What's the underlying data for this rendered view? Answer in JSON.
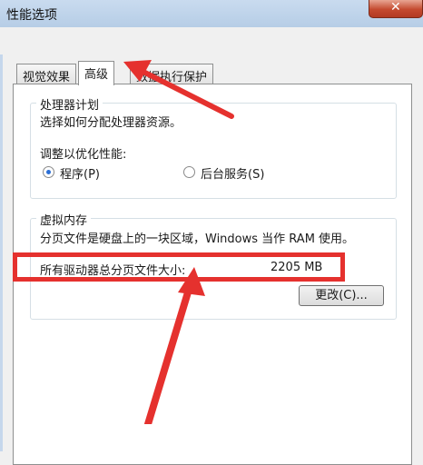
{
  "window": {
    "title": "性能选项",
    "close_glyph": "✕"
  },
  "tabs": [
    {
      "label": "视觉效果",
      "active": false
    },
    {
      "label": "高级",
      "active": true
    },
    {
      "label": "数据执行保护",
      "active": false
    }
  ],
  "processor": {
    "title": "处理器计划",
    "description": "选择如何分配处理器资源。",
    "adjust_label": "调整以优化性能:",
    "options": [
      {
        "label": "程序(P)",
        "selected": true
      },
      {
        "label": "后台服务(S)",
        "selected": false
      }
    ]
  },
  "virtual_memory": {
    "title": "虚拟内存",
    "description": "分页文件是硬盘上的一块区域，Windows 当作 RAM 使用。",
    "total_label": "所有驱动器总分页文件大小:",
    "total_value": "2205 MB",
    "change_button": "更改(C)..."
  },
  "annotation": {
    "color": "#e5312e"
  }
}
